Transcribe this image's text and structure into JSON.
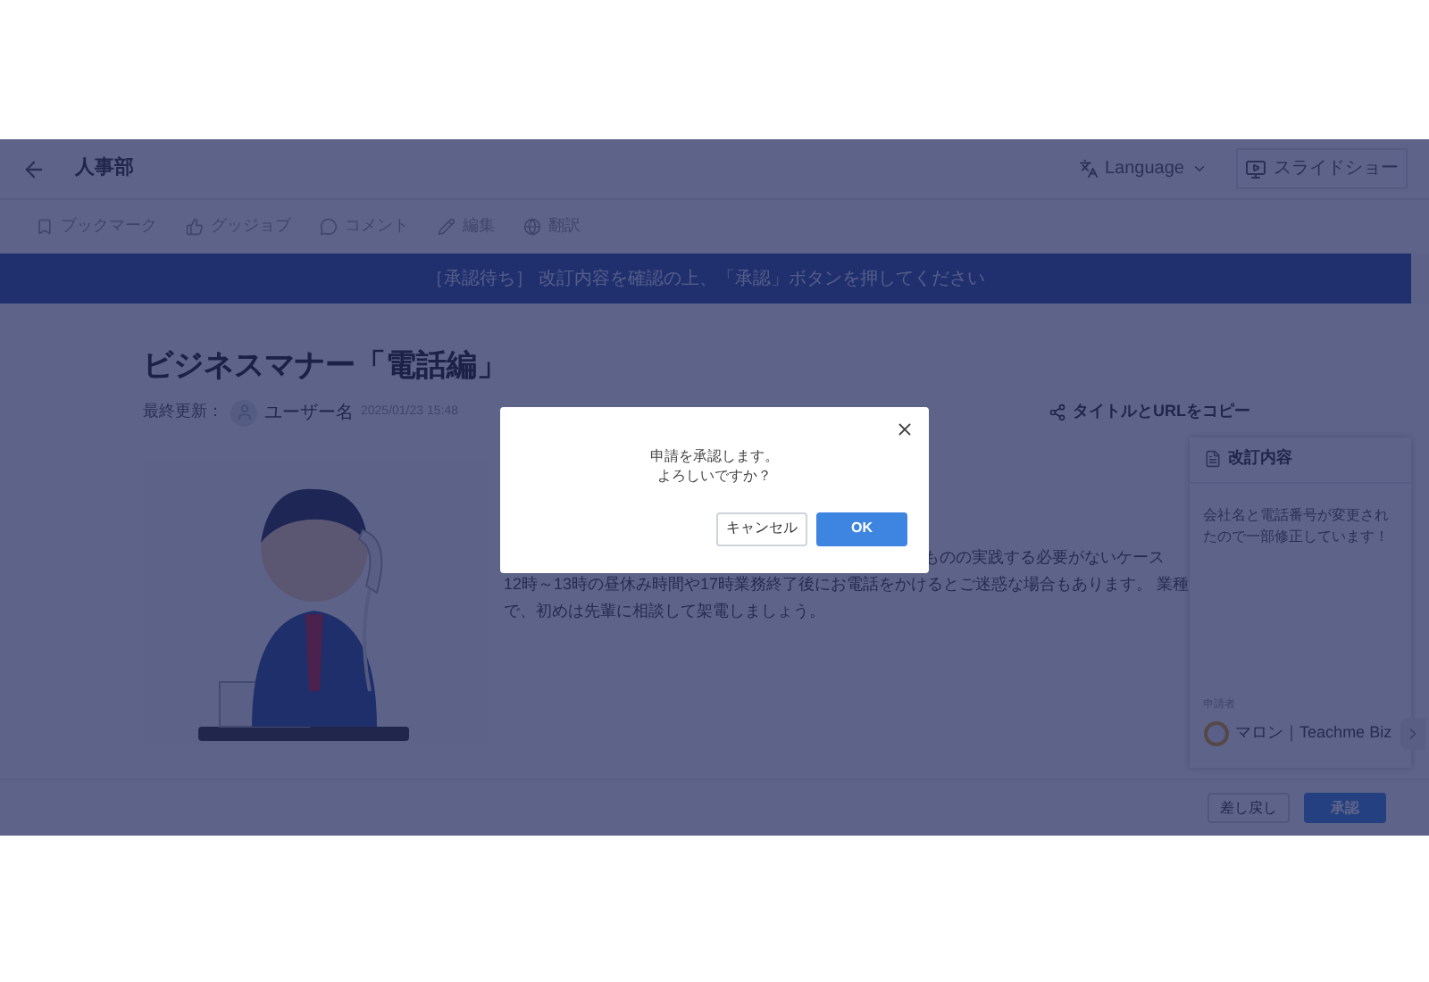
{
  "header": {
    "title": "人事部",
    "language": "Language",
    "slideshow": "スライドショー"
  },
  "toolbar": [
    {
      "kind": "bookmark",
      "label": "ブックマーク"
    },
    {
      "kind": "thumb",
      "label": "グッジョブ"
    },
    {
      "kind": "comment",
      "label": "コメント"
    },
    {
      "kind": "edit",
      "label": "編集"
    },
    {
      "kind": "translate",
      "label": "翻訳"
    }
  ],
  "banner": "［承認待ち］ 改訂内容を確認の上、「承認」ボタンを押してください",
  "article": {
    "title": "ビジネスマナー「電話編」",
    "updated_label": "最終更新：",
    "user": "ユーザー名",
    "date": "2025/01/23 15:48",
    "copy_link": "タイトルとURLをコピー",
    "body_lines": [
      "ものの実践する必要がないケース",
      "12時～13時の昼休み時間や17時業務終了後にお電話をかけるとご迷惑な場合もあります。 業種",
      "で、初めは先輩に相談して架電しましょう。"
    ]
  },
  "revision_panel": {
    "title": "改訂内容",
    "text": "会社名と電話番号が変更されたので一部修正しています！",
    "applicant_label": "申請者",
    "applicant": "マロン｜Teachme Biz"
  },
  "footer": {
    "buttons": [
      {
        "kind": "secondary",
        "label": "差し戻し"
      },
      {
        "kind": "primary",
        "label": "承認"
      }
    ]
  },
  "dialog": {
    "message_lines": [
      "申請を承認します。",
      "よろしいですか？"
    ],
    "buttons": [
      {
        "kind": "secondary",
        "label": "キャンセル"
      },
      {
        "kind": "primary",
        "label": "OK"
      }
    ]
  }
}
